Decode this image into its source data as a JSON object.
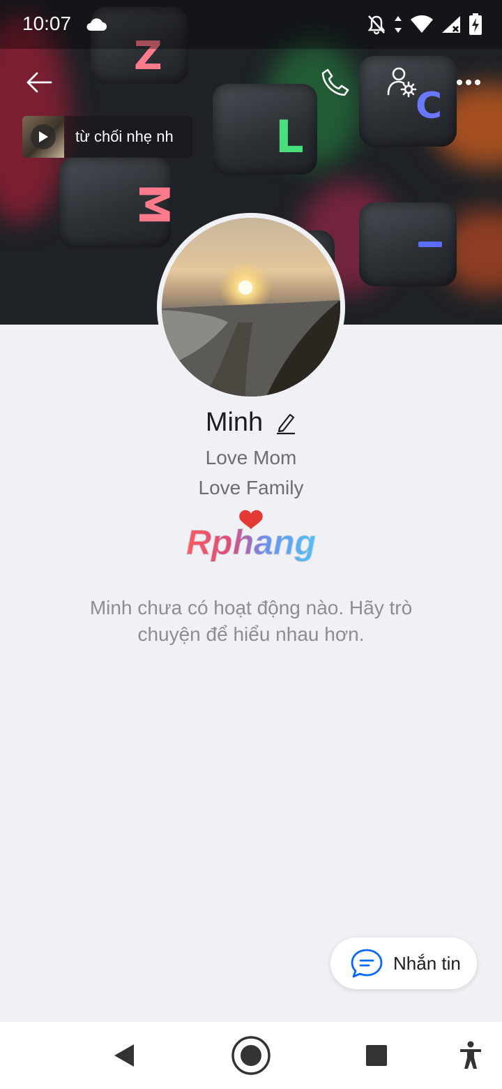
{
  "status_bar": {
    "time": "10:07"
  },
  "music": {
    "title": "từ chối nhẹ nh"
  },
  "profile": {
    "name": "Minh",
    "bio_line_1": "Love Mom",
    "bio_line_2": "Love Family",
    "brand_text": "Rphang",
    "empty_message": "Minh chưa có hoạt động nào. Hãy trò chuyện để hiểu nhau hơn."
  },
  "actions": {
    "message_label": "Nhắn tin"
  },
  "colors": {
    "accent": "#0068ff",
    "background": "#eff1f5",
    "heart": "#e53935"
  },
  "icons": [
    "back-arrow-icon",
    "phone-icon",
    "user-settings-icon",
    "more-icon",
    "play-icon",
    "edit-icon",
    "chat-bubble-icon",
    "nav-back-icon",
    "nav-home-icon",
    "nav-recents-icon",
    "accessibility-icon",
    "cloud-icon",
    "bell-off-icon",
    "data-arrows-icon",
    "wifi-icon",
    "signal-icon",
    "battery-icon"
  ]
}
